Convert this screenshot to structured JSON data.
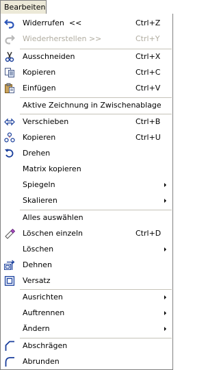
{
  "menubar": {
    "title": "Bearbeiten"
  },
  "menu": {
    "items": [
      {
        "label": "Widerrufen  <<",
        "shortcut": "Ctrl+Z",
        "icon": "undo-icon",
        "enabled": true,
        "submenu": false
      },
      {
        "label": "Wiederherstellen >>",
        "shortcut": "Ctrl+Y",
        "icon": "redo-icon",
        "enabled": false,
        "submenu": false
      },
      {
        "label": "Ausschneiden",
        "shortcut": "Ctrl+X",
        "icon": "scissors-icon",
        "enabled": true,
        "submenu": false
      },
      {
        "label": "Kopieren",
        "shortcut": "Ctrl+C",
        "icon": "copy-icon",
        "enabled": true,
        "submenu": false
      },
      {
        "label": "Einfügen",
        "shortcut": "Ctrl+V",
        "icon": "paste-icon",
        "enabled": true,
        "submenu": false
      },
      {
        "label": "Aktive Zeichnung in Zwischenablage",
        "shortcut": "",
        "icon": "",
        "enabled": true,
        "submenu": false
      },
      {
        "label": "Verschieben",
        "shortcut": "Ctrl+B",
        "icon": "move-arrows-icon",
        "enabled": true,
        "submenu": false
      },
      {
        "label": "Kopieren",
        "shortcut": "Ctrl+U",
        "icon": "copy-objects-icon",
        "enabled": true,
        "submenu": false
      },
      {
        "label": "Drehen",
        "shortcut": "",
        "icon": "rotate-icon",
        "enabled": true,
        "submenu": false
      },
      {
        "label": "Matrix kopieren",
        "shortcut": "",
        "icon": "",
        "enabled": true,
        "submenu": false
      },
      {
        "label": "Spiegeln",
        "shortcut": "",
        "icon": "",
        "enabled": true,
        "submenu": true
      },
      {
        "label": "Skalieren",
        "shortcut": "",
        "icon": "",
        "enabled": true,
        "submenu": true
      },
      {
        "label": "Alles auswählen",
        "shortcut": "",
        "icon": "",
        "enabled": true,
        "submenu": false
      },
      {
        "label": "Löschen einzeln",
        "shortcut": "Ctrl+D",
        "icon": "eraser-icon",
        "enabled": true,
        "submenu": false
      },
      {
        "label": "Löschen",
        "shortcut": "",
        "icon": "",
        "enabled": true,
        "submenu": true
      },
      {
        "label": "Dehnen",
        "shortcut": "",
        "icon": "stretch-icon",
        "enabled": true,
        "submenu": false
      },
      {
        "label": "Versatz",
        "shortcut": "",
        "icon": "offset-icon",
        "enabled": true,
        "submenu": false
      },
      {
        "label": "Ausrichten",
        "shortcut": "",
        "icon": "",
        "enabled": true,
        "submenu": true
      },
      {
        "label": "Auftrennen",
        "shortcut": "",
        "icon": "",
        "enabled": true,
        "submenu": true
      },
      {
        "label": "Ändern",
        "shortcut": "",
        "icon": "",
        "enabled": true,
        "submenu": true
      },
      {
        "label": "Abschrägen",
        "shortcut": "",
        "icon": "chamfer-icon",
        "enabled": true,
        "submenu": false
      },
      {
        "label": "Abrunden",
        "shortcut": "",
        "icon": "fillet-icon",
        "enabled": true,
        "submenu": false
      }
    ]
  },
  "colors": {
    "disabled_text": "#b0aca0",
    "separator": "#c5c2b8",
    "border": "#808080"
  }
}
